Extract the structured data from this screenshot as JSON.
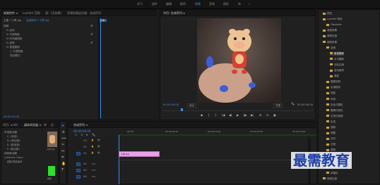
{
  "workspaces": [
    "学习",
    "组件",
    "编辑",
    "颜色",
    "效果",
    "音频",
    "图形",
    "库"
  ],
  "workspace_active": 4,
  "effect_controls": {
    "tabs": [
      "效果控件 ≡",
      "Lumetri 范围",
      "源：(无剪辑)",
      "音频剪辑混合器：合成序列"
    ],
    "clip_label": "主要 * 小青.jpg",
    "seq_label": "合成序列 * 小青.jpg",
    "sections": [
      "视频",
      "fx  运动",
      "fx  不透明度",
      "fx  时间重映射",
      "fx  变换",
      "fx  垂直翻转"
    ],
    "opacity_label": "○ 不透明度",
    "blend_label": "混合模式",
    "timecode": "00:00:00:00"
  },
  "program_monitor": {
    "tab": "节目: 合成序列 ≡",
    "timecode_left": "00:00:00:00",
    "fit": "适合",
    "quality": "完整",
    "timecode_right": "00:00:00:00",
    "controls": [
      "◆",
      "{",
      "}",
      "|◀",
      "◀|",
      "▶",
      "|▶",
      "▶|",
      "⊞",
      "⊡",
      "▣"
    ]
  },
  "effects_panel": {
    "items": [
      {
        "label": "预设",
        "indent": 0
      },
      {
        "label": "Lumetri 预设",
        "indent": 0
      },
      {
        "label": "Obsolete",
        "indent": 1
      },
      {
        "label": "音频效果",
        "indent": 0
      },
      {
        "label": "音频过渡",
        "indent": 0
      },
      {
        "label": "视频效果",
        "indent": 0
      },
      {
        "label": "变换",
        "indent": 1
      },
      {
        "label": "垂直翻转",
        "indent": 2,
        "selected": true
      },
      {
        "label": "水平翻转",
        "indent": 2
      },
      {
        "label": "羽化边缘",
        "indent": 2
      },
      {
        "label": "自动重构",
        "indent": 2
      },
      {
        "label": "裁剪",
        "indent": 2
      },
      {
        "label": "图像控制",
        "indent": 1
      },
      {
        "label": "实用程序",
        "indent": 1
      },
      {
        "label": "扭曲",
        "indent": 1
      },
      {
        "label": "时间",
        "indent": 1
      },
      {
        "label": "杂色与颗粒",
        "indent": 1
      },
      {
        "label": "模糊与锐化",
        "indent": 1
      },
      {
        "label": "沉浸式视频",
        "indent": 1
      },
      {
        "label": "生成",
        "indent": 1
      },
      {
        "label": "视频",
        "indent": 1
      },
      {
        "label": "调整",
        "indent": 1
      },
      {
        "label": "过时",
        "indent": 1
      },
      {
        "label": "过渡",
        "indent": 1
      },
      {
        "label": "透视",
        "indent": 1
      },
      {
        "label": "通道",
        "indent": 1
      },
      {
        "label": "键控",
        "indent": 1
      },
      {
        "label": "颜色校正",
        "indent": 1
      },
      {
        "label": "风格化",
        "indent": 1
      },
      {
        "label": "视频过渡",
        "indent": 0
      }
    ]
  },
  "project_panel": {
    "tabs": [
      "项目: untitl",
      "媒体浏览器 ≡",
      "库",
      "信"
    ],
    "tree": [
      "本地驱动器",
      "C: (系统)",
      "D: (新加卷)",
      "E: (新加卷)",
      "F: (新加卷)",
      "网络驱动器",
      "Creative Cloud",
      "团队项目版本"
    ],
    "thumb_labels": [
      "小青.jpg",
      "绿幕"
    ]
  },
  "timeline": {
    "tab": "合成序列 ≡",
    "timecode": "00:00:00:00",
    "track_labels": [
      "V3",
      "V2",
      "V1",
      "A1",
      "A2",
      "A3"
    ],
    "clip_label": "小青.jpg",
    "ruler": [
      "00:00",
      "00:00:05:00",
      "00:00:10:00",
      "00:00:15:00",
      "00:00:20:00"
    ]
  },
  "watermark": "最需教育",
  "colors": {
    "accent": "#3d8df5",
    "clip": "#e8a0e8",
    "folder": "#c9a449"
  }
}
